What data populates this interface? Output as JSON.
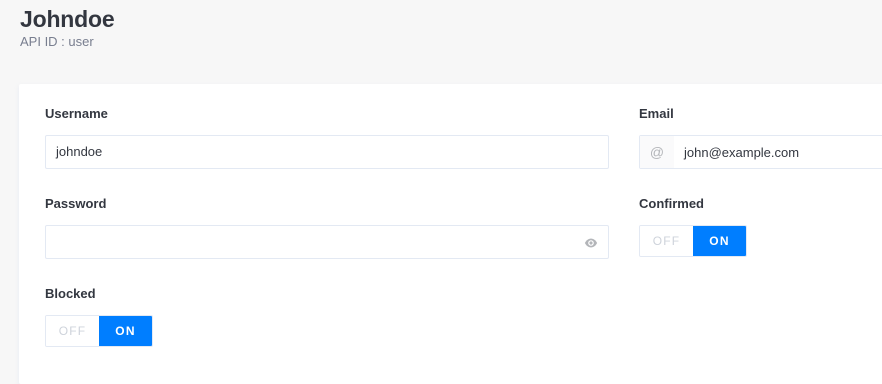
{
  "header": {
    "title": "Johndoe",
    "api_id": "API ID : user"
  },
  "form": {
    "username": {
      "label": "Username",
      "value": "johndoe"
    },
    "email": {
      "label": "Email",
      "prefix": "@",
      "value": "john@example.com"
    },
    "password": {
      "label": "Password",
      "value": "",
      "icon": "eye-icon"
    },
    "confirmed": {
      "label": "Confirmed",
      "off_label": "OFF",
      "on_label": "ON",
      "state": "on"
    },
    "blocked": {
      "label": "Blocked",
      "off_label": "OFF",
      "on_label": "ON",
      "state": "on"
    }
  },
  "colors": {
    "accent": "#007eff",
    "page_bg": "#f7f7f7",
    "border": "#e3e9f3"
  }
}
